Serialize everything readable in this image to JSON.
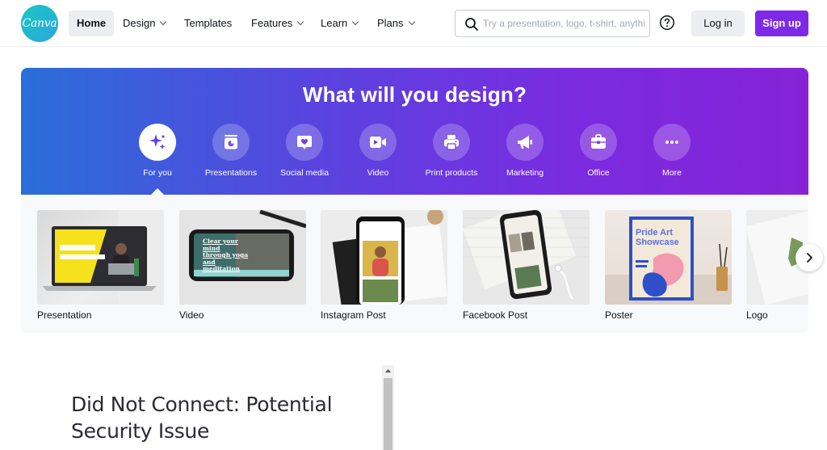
{
  "header": {
    "logo_text": "Canva",
    "nav": [
      {
        "label": "Home",
        "dropdown": false
      },
      {
        "label": "Design",
        "dropdown": true
      },
      {
        "label": "Templates",
        "dropdown": false
      },
      {
        "label": "Features",
        "dropdown": true
      },
      {
        "label": "Learn",
        "dropdown": true
      },
      {
        "label": "Plans",
        "dropdown": true
      }
    ],
    "search_placeholder": "Try a presentation, logo, t-shirt, anything",
    "login_label": "Log in",
    "signup_label": "Sign up"
  },
  "hero": {
    "title": "What will you design?",
    "categories": [
      {
        "label": "For you",
        "icon": "sparkle-icon",
        "selected": true
      },
      {
        "label": "Presentations",
        "icon": "presentation-icon",
        "selected": false
      },
      {
        "label": "Social media",
        "icon": "heart-chat-icon",
        "selected": false
      },
      {
        "label": "Video",
        "icon": "video-camera-icon",
        "selected": false
      },
      {
        "label": "Print products",
        "icon": "printer-icon",
        "selected": false
      },
      {
        "label": "Marketing",
        "icon": "megaphone-icon",
        "selected": false
      },
      {
        "label": "Office",
        "icon": "briefcase-icon",
        "selected": false
      },
      {
        "label": "More",
        "icon": "more-dots-icon",
        "selected": false
      }
    ]
  },
  "templates": [
    {
      "label": "Presentation"
    },
    {
      "label": "Video",
      "thumb_text": "Clear your mind through yoga and meditation"
    },
    {
      "label": "Instagram Post"
    },
    {
      "label": "Facebook Post"
    },
    {
      "label": "Poster",
      "thumb_text": "Pride Art Showcase"
    },
    {
      "label": "Logo"
    }
  ],
  "error_page": {
    "title": "Did Not Connect: Potential Security Issue"
  },
  "colors": {
    "brand_purple": "#7d2ae8",
    "hero_gradient_start": "#2a6ed9",
    "hero_gradient_end": "#8623d8",
    "logo_teal": "#1cc5c5"
  }
}
